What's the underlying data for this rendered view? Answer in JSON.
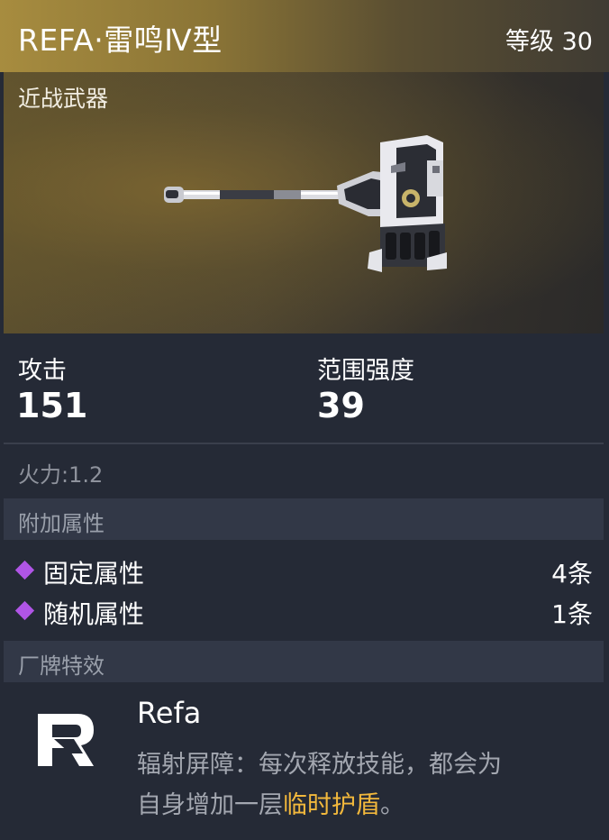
{
  "header": {
    "title": "REFA·雷鸣Ⅳ型",
    "level": "等级 30",
    "accent_color": "#a78c3f"
  },
  "image": {
    "category": "近战武器",
    "icon": "hammer-weapon-image"
  },
  "stats": {
    "attack_label": "攻击",
    "attack_value": "151",
    "range_label": "范围强度",
    "range_value": "39"
  },
  "firepower": "火力:1.2",
  "extra_attributes": {
    "title": "附加属性",
    "items": [
      {
        "label": "固定属性",
        "count": "4条",
        "icon": "purple-diamond-icon"
      },
      {
        "label": "随机属性",
        "count": "1条",
        "icon": "purple-diamond-icon"
      }
    ],
    "diamond_color": "#b055e6"
  },
  "brand_effect": {
    "title": "厂牌特效",
    "logo": "refa-logo-icon",
    "name": "Refa",
    "desc_line1": "辐射屏障：每次释放技能，都会为",
    "desc_line2_prefix": "自身增加一层",
    "desc_highlight": "临时护盾",
    "desc_suffix": "。",
    "highlight_color": "#f2b83c"
  }
}
